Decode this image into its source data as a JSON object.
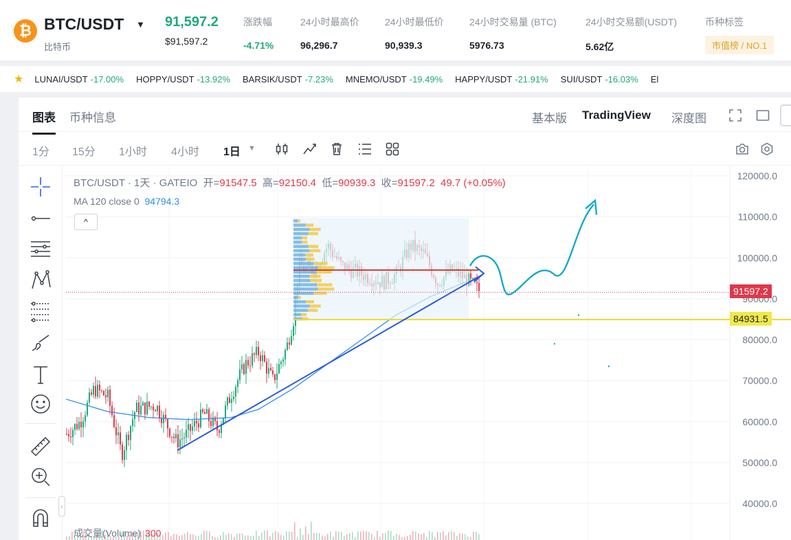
{
  "header": {
    "coin_symbol": "₿",
    "pair": "BTC/USDT",
    "caret": "▼",
    "coin_name": "比特币",
    "last_price": "91,597.2",
    "last_price_usd": "$91,597.2",
    "stats": [
      {
        "label": "涨跌幅",
        "value": "-4.71%"
      },
      {
        "label": "24小时最高价",
        "value": "96,296.7"
      },
      {
        "label": "24小时最低价",
        "value": "90,939.3"
      },
      {
        "label": "24小时交易量 (BTC)",
        "value": "5976.73"
      },
      {
        "label": "24小时交易额(USDT)",
        "value": "5.62亿"
      }
    ],
    "tag_label": "币种标签",
    "tag_value": "市值榜 / NO.1"
  },
  "ticker": {
    "items": [
      {
        "pair": "LUNAI/USDT",
        "pct": "-17.00%"
      },
      {
        "pair": "HOPPY/USDT",
        "pct": "-13.92%"
      },
      {
        "pair": "BARSIK/USDT",
        "pct": "-7.23%"
      },
      {
        "pair": "MNEMO/USDT",
        "pct": "-19.49%"
      },
      {
        "pair": "HAPPY/USDT",
        "pct": "-21.91%"
      },
      {
        "pair": "SUI/USDT",
        "pct": "-16.03%"
      },
      {
        "pair": "El",
        "pct": ""
      }
    ]
  },
  "tabs": {
    "chart": "图表",
    "info": "币种信息",
    "basic": "基本版",
    "tradingview": "TradingView",
    "depth": "深度图"
  },
  "timeframes": {
    "t1": "1分",
    "t2": "15分",
    "t3": "1小时",
    "t4": "4小时",
    "t5": "1日",
    "t5_caret": "▼"
  },
  "chart": {
    "legend_title": "BTC/USDT · 1天 · GATEIO",
    "open_label": "开=",
    "open": "91547.5",
    "high_label": "高=",
    "high": "92150.4",
    "low_label": "低=",
    "low": "90939.3",
    "close_label": "收=",
    "close": "91597.2",
    "change": "49.7 (+0.05%)",
    "ma_label": "MA 120 close 0",
    "ma_value": "94794.3",
    "collapse_symbol": "^",
    "volume_label": "成交量(Volume)",
    "volume_value": "300",
    "current_price_tag": "91597.2",
    "level_tag": "84931.5",
    "colors": {
      "up": "#1fa97a",
      "down": "#e0384b",
      "ma": "#2d8ee8",
      "trend": "#2a5bd7",
      "drawing": "#17a9c9",
      "level": "#f0d730",
      "hline": "#d0281f"
    }
  },
  "chart_data": {
    "type": "candlestick",
    "title": "BTC/USDT · 1天 · GATEIO",
    "y_ticks": [
      "120000.0",
      "110000.0",
      "100000.0",
      "90000.0",
      "80000.0",
      "70000.0",
      "60000.0",
      "50000.0",
      "40000.0"
    ],
    "ylim": [
      36000,
      122000
    ],
    "current_price": 91597.2,
    "level_line": 84931.5,
    "grid": true
  }
}
